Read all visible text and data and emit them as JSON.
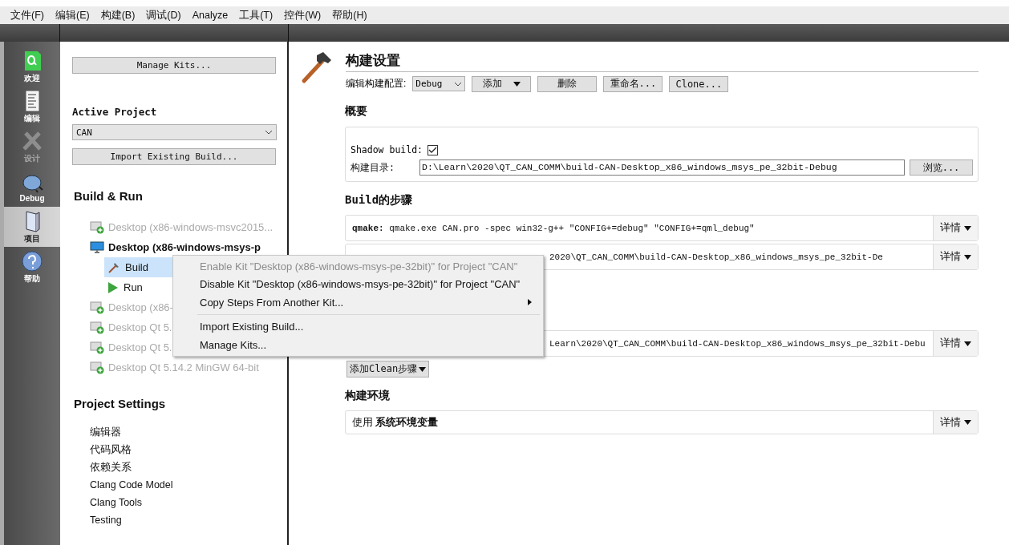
{
  "menu_bar": [
    "文件(F)",
    "编辑(E)",
    "构建(B)",
    "调试(D)",
    "Analyze",
    "工具(T)",
    "控件(W)",
    "帮助(H)"
  ],
  "mode_bar": [
    {
      "kind": "welcome",
      "label": "欢迎",
      "selected": false,
      "disabled": false
    },
    {
      "kind": "edit",
      "label": "编辑",
      "selected": false,
      "disabled": false
    },
    {
      "kind": "design",
      "label": "设计",
      "selected": false,
      "disabled": true
    },
    {
      "kind": "debug",
      "label": "Debug",
      "selected": false,
      "disabled": false
    },
    {
      "kind": "projects",
      "label": "项目",
      "selected": true,
      "disabled": false
    },
    {
      "kind": "help",
      "label": "帮助",
      "selected": false,
      "disabled": false
    }
  ],
  "kit_panel": {
    "manage_kits_button": "Manage Kits...",
    "active_project_label": "Active Project",
    "project_combo": "CAN",
    "import_button": "Import Existing Build...",
    "build_run_heading": "Build & Run",
    "kits": [
      {
        "label": "Desktop (x86-windows-msvc2015...",
        "enabled": false
      },
      {
        "label": "Desktop (x86-windows-msys-p",
        "enabled": true,
        "children": [
          {
            "kind": "build",
            "label": "Build",
            "selected": true
          },
          {
            "kind": "run",
            "label": "Run",
            "selected": false
          }
        ]
      },
      {
        "label": "Desktop (x86-",
        "enabled": false
      },
      {
        "label": "Desktop Qt 5.",
        "enabled": false
      },
      {
        "label": "Desktop Qt 5.",
        "enabled": false
      },
      {
        "label": "Desktop Qt 5.14.2 MinGW 64-bit",
        "enabled": false
      }
    ],
    "project_settings_heading": "Project Settings",
    "project_settings": [
      "编辑器",
      "代码风格",
      "依赖关系",
      "Clang Code Model",
      "Clang Tools",
      "Testing"
    ]
  },
  "build_settings": {
    "title": "构建设置",
    "config_label": "编辑构建配置:",
    "config_combo": "Debug",
    "buttons": [
      {
        "label": "添加",
        "dropdown": true
      },
      {
        "label": "删除",
        "dropdown": false
      },
      {
        "label": "重命名...",
        "dropdown": false
      },
      {
        "label": "Clone...",
        "dropdown": false
      }
    ],
    "overview_heading": "概要",
    "shadow_build_label": "Shadow build:",
    "shadow_build_checked": true,
    "build_dir_label": "构建目录:",
    "build_dir": "D:\\Learn\\2020\\QT_CAN_COMM\\build-CAN-Desktop_x86_windows_msys_pe_32bit-Debug",
    "browse_button": "浏览...",
    "steps_heading": "Build的步骤",
    "build_steps": [
      {
        "text": "**qmake:** qmake.exe CAN.pro -spec win32-g++ \"CONFIG+=debug\" \"CONFIG+=qml_debug\"",
        "details": "详情"
      },
      {
        "text": "2020\\QT_CAN_COMM\\build-CAN-Desktop_x86_windows_msys_pe_32bit-De",
        "details": "详情"
      }
    ],
    "clean_steps": [
      {
        "text": "Learn\\2020\\QT_CAN_COMM\\build-CAN-Desktop_x86_windows_msys_pe_32bit-Debu",
        "details": "详情"
      }
    ],
    "add_clean_button": "添加Clean步骤",
    "env_heading": "构建环境",
    "env_text": "使用  **系统环境变量**",
    "env_details": "详情"
  },
  "context_menu": [
    {
      "kind": "item",
      "label": "Enable Kit \"Desktop (x86-windows-msys-pe-32bit)\" for Project \"CAN\"",
      "disabled": true
    },
    {
      "kind": "item",
      "label": "Disable Kit \"Desktop (x86-windows-msys-pe-32bit)\" for Project \"CAN\"",
      "disabled": false
    },
    {
      "kind": "submenu",
      "label": "Copy Steps From Another Kit...",
      "disabled": false
    },
    {
      "kind": "separator"
    },
    {
      "kind": "item",
      "label": "Import Existing Build...",
      "disabled": false
    },
    {
      "kind": "item",
      "label": "Manage Kits...",
      "disabled": false
    }
  ]
}
